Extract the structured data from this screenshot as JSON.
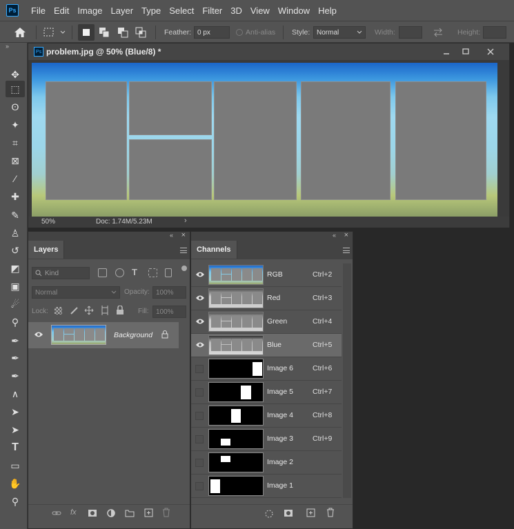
{
  "app": {
    "logo": "Ps"
  },
  "menu": [
    "File",
    "Edit",
    "Image",
    "Layer",
    "Type",
    "Select",
    "Filter",
    "3D",
    "View",
    "Window",
    "Help"
  ],
  "options": {
    "feather_label": "Feather:",
    "feather_value": "0 px",
    "antialias_label": "Anti-alias",
    "style_label": "Style:",
    "style_value": "Normal",
    "width_label": "Width:",
    "height_label": "Height:"
  },
  "tools": [
    "move-icon",
    "marquee-icon",
    "lasso-icon",
    "magic-wand-icon",
    "crop-icon",
    "frame-icon",
    "eyedropper-icon",
    "healing-icon",
    "brush-icon",
    "stamp-icon",
    "history-brush-icon",
    "eraser-icon",
    "gradient-icon",
    "blur-icon",
    "dodge-icon",
    "pen-icon",
    "freeform-pen-icon",
    "add-anchor-icon",
    "convert-anchor-icon",
    "path-selection-icon",
    "direct-selection-icon",
    "type-icon",
    "ellipse-icon",
    "hand-icon",
    "zoom-icon"
  ],
  "document": {
    "title": "problem.jpg @ 50% (Blue/8) *",
    "zoom": "50%",
    "doc_info": "Doc: 1.74M/5.23M"
  },
  "layers_panel": {
    "tab": "Layers",
    "kind_placeholder": "Kind",
    "blend_mode": "Normal",
    "opacity_label": "Opacity:",
    "opacity_value": "100%",
    "lock_label": "Lock:",
    "fill_label": "Fill:",
    "fill_value": "100%",
    "layers": [
      {
        "name": "Background",
        "locked": true,
        "visible": true
      }
    ]
  },
  "channels_panel": {
    "tab": "Channels",
    "channels": [
      {
        "name": "RGB",
        "shortcut": "Ctrl+2",
        "visible": true,
        "selected": false
      },
      {
        "name": "Red",
        "shortcut": "Ctrl+3",
        "visible": true,
        "selected": false
      },
      {
        "name": "Green",
        "shortcut": "Ctrl+4",
        "visible": true,
        "selected": false
      },
      {
        "name": "Blue",
        "shortcut": "Ctrl+5",
        "visible": true,
        "selected": true
      },
      {
        "name": "Image 6",
        "shortcut": "Ctrl+6",
        "visible": false,
        "selected": false
      },
      {
        "name": "Image 5",
        "shortcut": "Ctrl+7",
        "visible": false,
        "selected": false
      },
      {
        "name": "Image 4",
        "shortcut": "Ctrl+8",
        "visible": false,
        "selected": false
      },
      {
        "name": "Image 3",
        "shortcut": "Ctrl+9",
        "visible": false,
        "selected": false
      },
      {
        "name": "Image 2",
        "shortcut": "",
        "visible": false,
        "selected": false
      },
      {
        "name": "Image 1",
        "shortcut": "",
        "visible": false,
        "selected": false
      }
    ]
  }
}
